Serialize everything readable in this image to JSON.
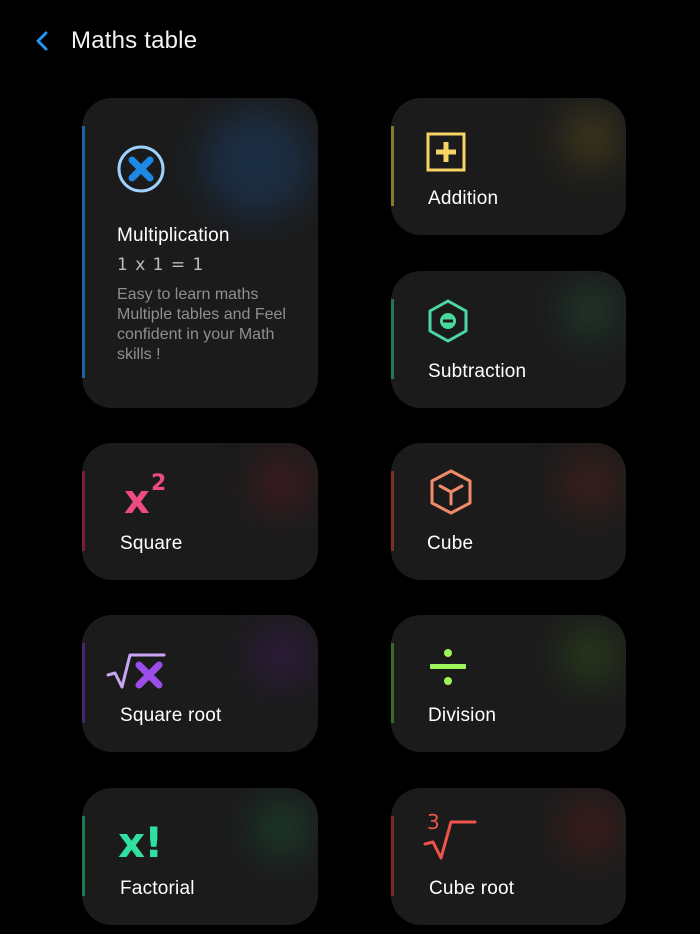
{
  "header": {
    "title": "Maths table",
    "back_icon": "chevron-left-icon"
  },
  "accent_color": "#1e88e5",
  "cards": {
    "multiplication": {
      "label": "Multiplication",
      "equation": "1 x 1 =  1",
      "description": "Easy to learn maths Multiple tables and Feel confident  in your Math skills !",
      "icon": "multiply-circle-icon",
      "color": "#1e88e5"
    },
    "addition": {
      "label": "Addition",
      "icon": "plus-square-icon",
      "color": "#f6d365"
    },
    "subtraction": {
      "label": "Subtraction",
      "icon": "minus-hexagon-icon",
      "color": "#4cd6a0"
    },
    "square": {
      "label": "Square",
      "icon": "x-squared-icon",
      "symbol": "x",
      "power": "2",
      "color": "#ef4b83"
    },
    "cube": {
      "label": "Cube",
      "icon": "cube-icon",
      "color": "#f08a6b"
    },
    "square_root": {
      "label": "Square root",
      "icon": "square-root-icon",
      "color": "#9b4dea"
    },
    "division": {
      "label": "Division",
      "icon": "divide-icon",
      "color": "#9ef55a"
    },
    "factorial": {
      "label": "Factorial",
      "icon": "factorial-icon",
      "symbol": "x!",
      "color": "#2fe0a0"
    },
    "cube_root": {
      "label": "Cube root",
      "icon": "cube-root-icon",
      "index": "3",
      "color": "#f0534a"
    }
  }
}
